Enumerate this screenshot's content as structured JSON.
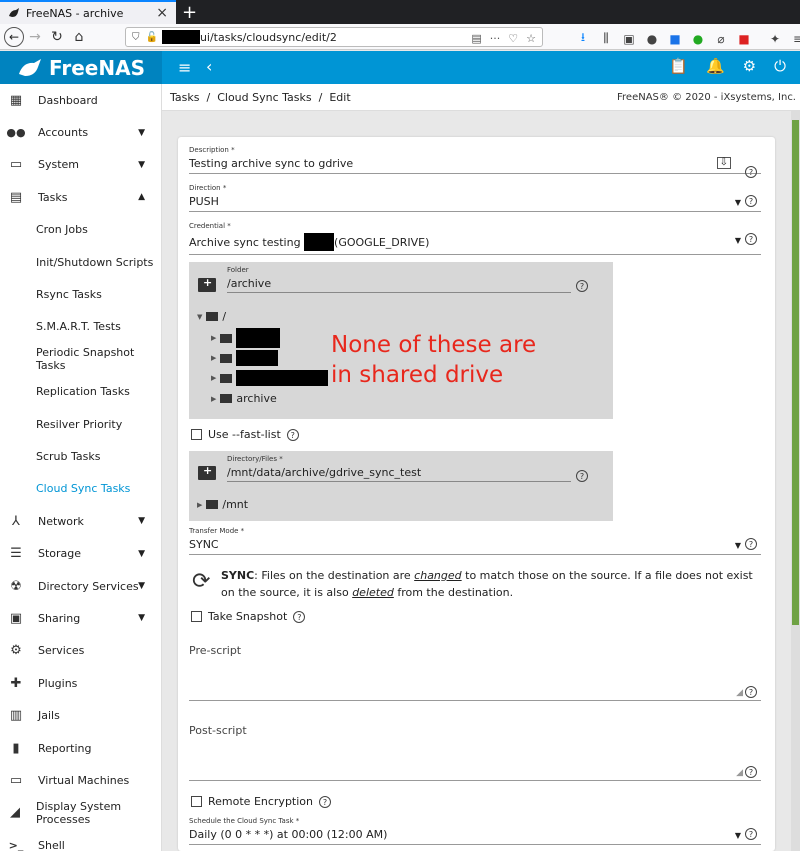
{
  "browser": {
    "tab_title": "FreeNAS - archive",
    "tab_close": "×",
    "new_tab": "+",
    "url_path": "ui/tasks/cloudsync/edit/2",
    "url_more": "···"
  },
  "app": {
    "logo": "FreeNAS",
    "hamburger": "≡",
    "back": "‹"
  },
  "sidebar": {
    "items": [
      {
        "label": "Dashboard",
        "icon": "dashboard-icon",
        "glyph": "▦"
      },
      {
        "label": "Accounts",
        "icon": "accounts-icon",
        "glyph": "👥"
      },
      {
        "label": "System",
        "icon": "system-icon",
        "glyph": "▭"
      },
      {
        "label": "Tasks",
        "icon": "tasks-icon",
        "glyph": "▤"
      },
      {
        "label": "Cron Jobs"
      },
      {
        "label": "Init/Shutdown Scripts"
      },
      {
        "label": "Rsync Tasks"
      },
      {
        "label": "S.M.A.R.T. Tests"
      },
      {
        "label": "Periodic Snapshot Tasks"
      },
      {
        "label": "Replication Tasks"
      },
      {
        "label": "Resilver Priority"
      },
      {
        "label": "Scrub Tasks"
      },
      {
        "label": "Cloud Sync Tasks"
      },
      {
        "label": "Network",
        "icon": "network-icon",
        "glyph": "⅄"
      },
      {
        "label": "Storage",
        "icon": "storage-icon",
        "glyph": "☰"
      },
      {
        "label": "Directory Services",
        "icon": "directory-services-icon",
        "glyph": "☢"
      },
      {
        "label": "Sharing",
        "icon": "sharing-icon",
        "glyph": "▣"
      },
      {
        "label": "Services",
        "icon": "services-icon",
        "glyph": "⚙"
      },
      {
        "label": "Plugins",
        "icon": "plugins-icon",
        "glyph": "✚"
      },
      {
        "label": "Jails",
        "icon": "jails-icon",
        "glyph": "▥"
      },
      {
        "label": "Reporting",
        "icon": "reporting-icon",
        "glyph": "▮"
      },
      {
        "label": "Virtual Machines",
        "icon": "virtual-machines-icon",
        "glyph": "▭"
      },
      {
        "label": "Display System Processes",
        "icon": "processes-icon",
        "glyph": "◢"
      },
      {
        "label": "Shell",
        "icon": "shell-icon",
        "glyph": ">_"
      }
    ]
  },
  "breadcrumb": {
    "crumb1": "Tasks",
    "sep": "/",
    "crumb2": "Cloud Sync Tasks",
    "crumb3": "Edit",
    "copyright": "FreeNAS® © 2020 - iXsystems, Inc."
  },
  "form": {
    "description": {
      "label": "Description *",
      "value": "Testing archive sync to gdrive"
    },
    "direction": {
      "label": "Direction *",
      "value": "PUSH"
    },
    "credential": {
      "label": "Credential *",
      "value_prefix": "Archive sync testing",
      "value_suffix": "(GOOGLE_DRIVE)"
    },
    "folder": {
      "label": "Folder",
      "value": "/archive",
      "tree_root": "/",
      "tree_last": "archive"
    },
    "fast_list": {
      "label": "Use --fast-list"
    },
    "directory": {
      "label": "Directory/Files *",
      "value": "/mnt/data/archive/gdrive_sync_test",
      "tree_root": "/mnt"
    },
    "transfer_mode": {
      "label": "Transfer Mode *",
      "value": "SYNC"
    },
    "sync_info": {
      "strong": "SYNC",
      "t1": ": Files on the destination are ",
      "em1": "changed",
      "t2": " to match those on the source. If a file does not exist on the source, it is also ",
      "em2": "deleted",
      "t3": " from the destination."
    },
    "take_snapshot": {
      "label": "Take Snapshot"
    },
    "pre_script": {
      "label": "Pre-script"
    },
    "post_script": {
      "label": "Post-script"
    },
    "remote_encryption": {
      "label": "Remote Encryption"
    },
    "schedule": {
      "label": "Schedule the Cloud Sync Task *",
      "value": "Daily (0 0 * * *) at 00:00 (12:00 AM)"
    }
  },
  "annotation": {
    "line1": "None of these are",
    "line2": "in shared drive"
  },
  "colors": {
    "brand": "#0095d5",
    "active_link": "#0095d5",
    "annotation": "#e8271c"
  }
}
